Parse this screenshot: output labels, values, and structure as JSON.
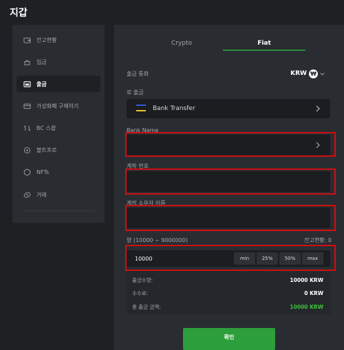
{
  "page_title": "지갑",
  "sidebar": {
    "items": [
      {
        "label": "잔고현황",
        "icon": "wallet-icon",
        "active": false
      },
      {
        "label": "입금",
        "icon": "deposit-icon",
        "active": false
      },
      {
        "label": "출금",
        "icon": "withdraw-icon",
        "active": true
      },
      {
        "label": "가상화폐 구매하기",
        "icon": "card-icon",
        "active": false
      },
      {
        "label": "BC 스왑",
        "icon": "swap-icon",
        "active": false
      },
      {
        "label": "볼트프로",
        "icon": "vault-icon",
        "active": false
      },
      {
        "label": "NFTs",
        "icon": "nft-icon",
        "active": false
      },
      {
        "label": "거래",
        "icon": "transactions-icon",
        "active": false
      }
    ]
  },
  "tabs": [
    {
      "label": "Crypto",
      "active": false
    },
    {
      "label": "Fiat",
      "active": true
    }
  ],
  "withdraw": {
    "currency_label": "출금 통화",
    "currency_code": "KRW",
    "currency_symbol": "₩",
    "method_label": "로 출금",
    "method_value": "Bank Transfer",
    "bank_name_label": "Bank Name",
    "account_number_label": "계좌 번호",
    "account_holder_label": "계정 소유자 이름",
    "amount_label": "양 (10000 ~ 9000000)",
    "balance_label": "잔고현황: 0",
    "amount_value": "10000",
    "quick_buttons": [
      "min",
      "25%",
      "50%",
      "max"
    ]
  },
  "summary": {
    "withdraw_amount_label": "출금수량:",
    "withdraw_amount_value": "10000 KRW",
    "fee_label": "수수료:",
    "fee_value": "0 KRW",
    "total_label": "총 출금 금액:",
    "total_value": "10000 KRW"
  },
  "confirm_label": "확인",
  "colors": {
    "accent_green": "#2c9e3b",
    "highlight_red": "#d40d12",
    "total_green": "#3cc23c"
  }
}
